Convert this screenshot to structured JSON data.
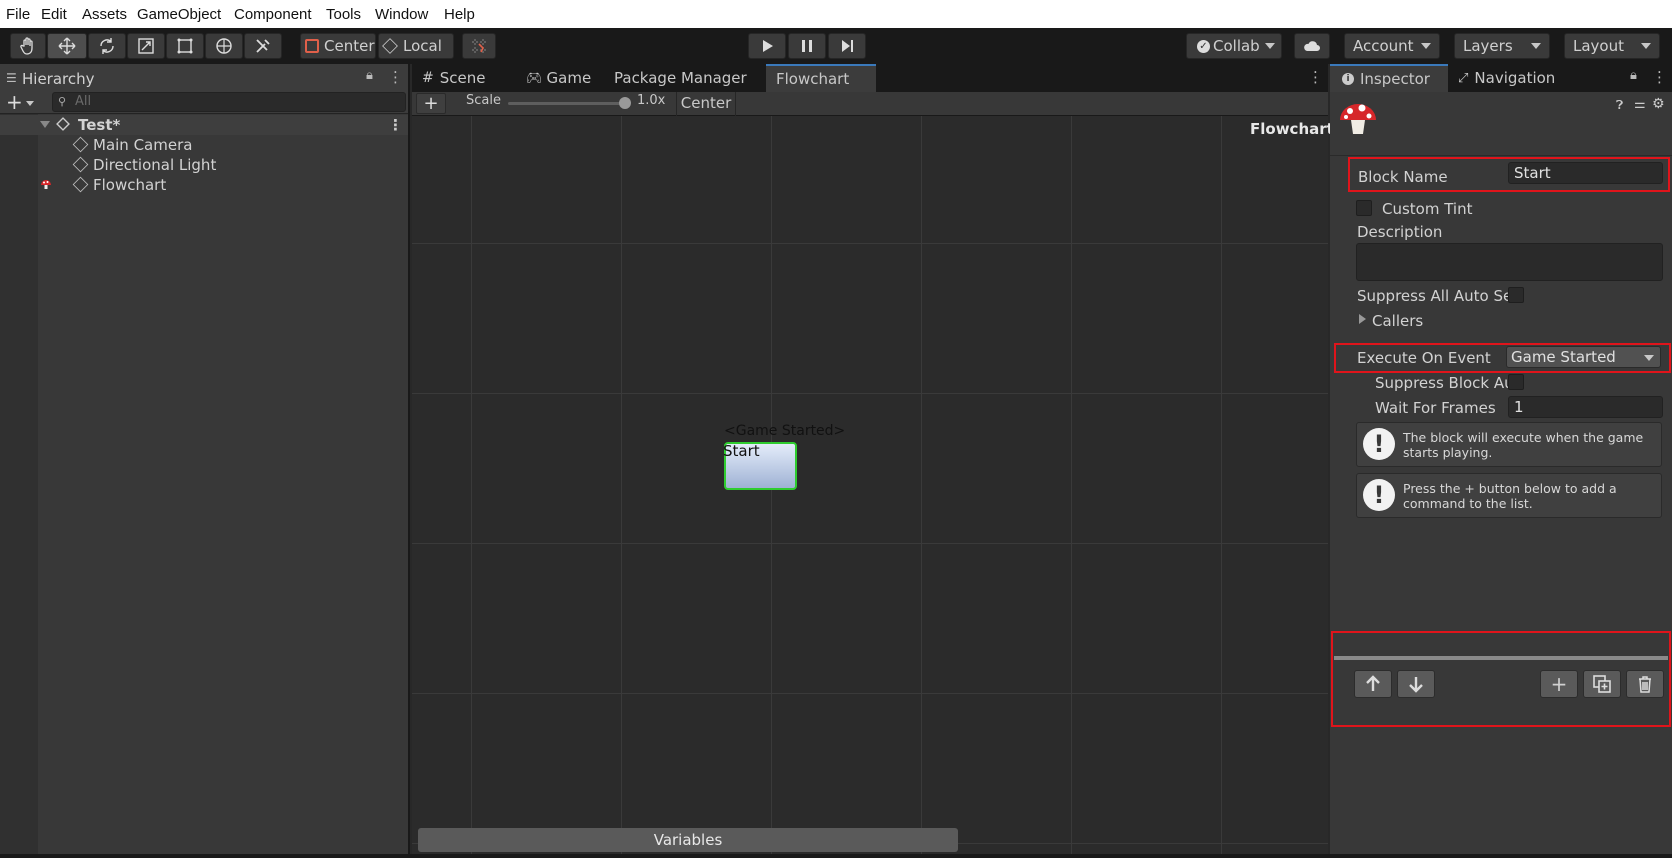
{
  "menu": [
    "File",
    "Edit",
    "Assets",
    "GameObject",
    "Component",
    "Tools",
    "Window",
    "Help"
  ],
  "toolbar": {
    "pivot_label": "Center",
    "space_label": "Local",
    "collab_label": "Collab",
    "account_label": "Account",
    "layers_label": "Layers",
    "layout_label": "Layout"
  },
  "hierarchy": {
    "tab_label": "Hierarchy",
    "search_placeholder": "All",
    "scene_name": "Test*",
    "items": [
      "Main Camera",
      "Directional Light",
      "Flowchart"
    ]
  },
  "center_tabs": [
    "Scene",
    "Game",
    "Package Manager",
    "Flowchart"
  ],
  "flowchart": {
    "scale_label": "Scale",
    "scale_value": "1.0x",
    "scale_fraction": 1.0,
    "center_label": "Center",
    "canvas_title": "Flowchart",
    "block_event": "<Game Started>",
    "block_name": "Start",
    "variables_label": "Variables"
  },
  "inspector": {
    "tab_label": "Inspector",
    "nav_tab_label": "Navigation",
    "block_name_label": "Block Name",
    "block_name_value": "Start",
    "custom_tint_label": "Custom Tint",
    "description_label": "Description",
    "suppress_all_label": "Suppress All Auto Se",
    "callers_label": "Callers",
    "execute_on_event_label": "Execute On Event",
    "execute_on_event_value": "Game Started",
    "suppress_block_label": "Suppress Block Au",
    "wait_for_frames_label": "Wait For Frames",
    "wait_for_frames_value": "1",
    "help_1": "The block will execute when the game starts playing.",
    "help_2": "Press the + button below to add a command to the list."
  },
  "colors": {
    "accent": "#3a79bb",
    "highlight_red": "#e0141b",
    "block_border": "#2fcc2f"
  }
}
